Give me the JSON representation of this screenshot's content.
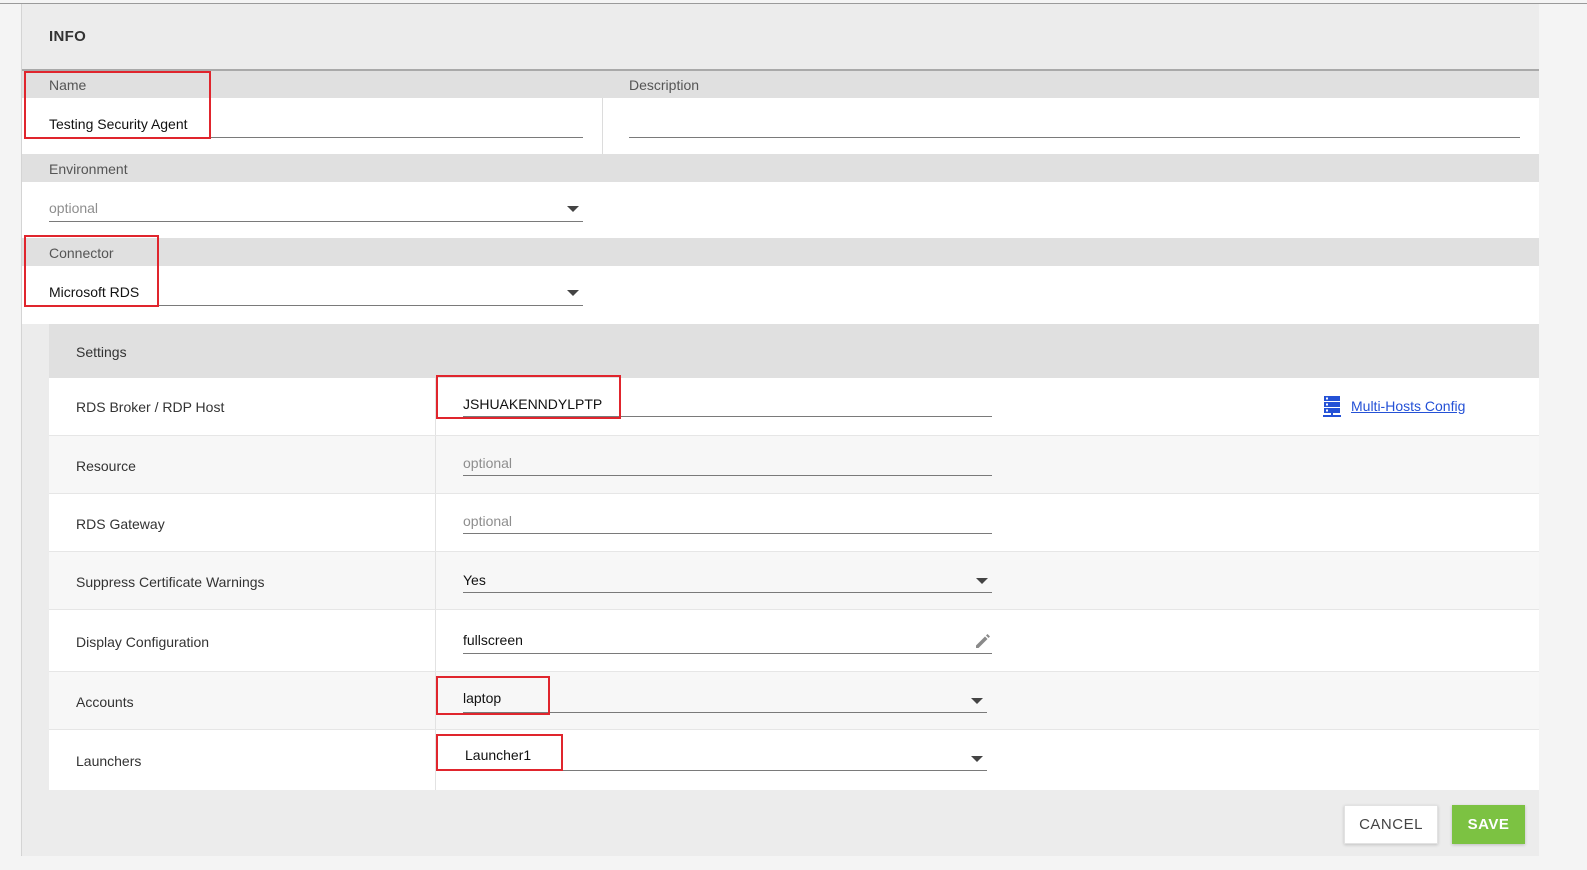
{
  "info": {
    "title": "INFO"
  },
  "fields": {
    "name": {
      "label": "Name",
      "value": "Testing Security Agent"
    },
    "description": {
      "label": "Description",
      "value": ""
    },
    "environment": {
      "label": "Environment",
      "placeholder": "optional"
    },
    "connector": {
      "label": "Connector",
      "value": "Microsoft RDS"
    }
  },
  "settings": {
    "title": "Settings",
    "rows": [
      {
        "label": "RDS Broker / RDP Host",
        "value": "JSHUAKENNDYLPTP",
        "type": "input"
      },
      {
        "label": "Resource",
        "placeholder": "optional",
        "type": "input"
      },
      {
        "label": "RDS Gateway",
        "placeholder": "optional",
        "type": "input"
      },
      {
        "label": "Suppress Certificate Warnings",
        "value": "Yes",
        "type": "select"
      },
      {
        "label": "Display Configuration",
        "value": "fullscreen",
        "type": "edit"
      },
      {
        "label": "Accounts",
        "value": "laptop",
        "type": "select"
      },
      {
        "label": "Launchers",
        "value": "Launcher1",
        "type": "select"
      }
    ],
    "multi_hosts_link": "Multi-Hosts Config"
  },
  "footer": {
    "cancel_label": "CANCEL",
    "save_label": "SAVE"
  },
  "colors": {
    "accent_save": "#7cc242",
    "highlight_box": "#e0252d",
    "link": "#2451d6"
  },
  "icons": {
    "multi_hosts": "server-icon",
    "display_edit": "pencil-icon",
    "dropdown": "caret-down-icon"
  }
}
